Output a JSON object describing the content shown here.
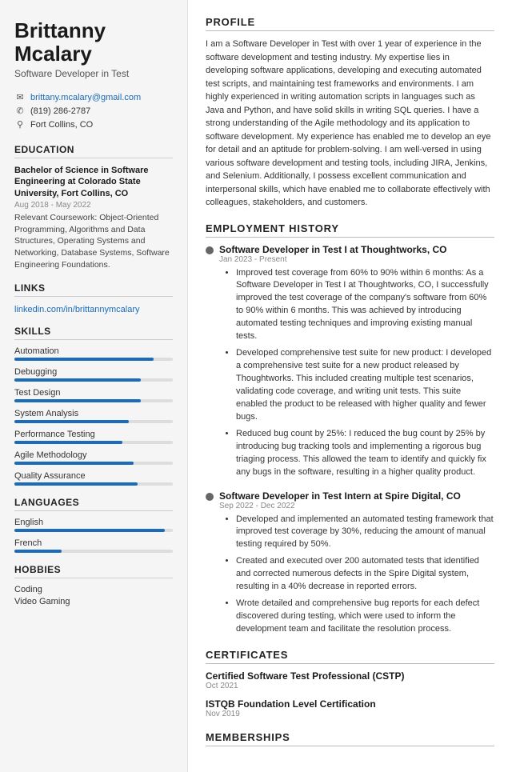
{
  "sidebar": {
    "name_line1": "Brittanny",
    "name_line2": "Mcalary",
    "title": "Software Developer in Test",
    "contact": {
      "email": "brittany.mcalary@gmail.com",
      "phone": "(819) 286-2787",
      "location": "Fort Collins, CO"
    },
    "sections": {
      "education": "EDUCATION",
      "links": "LINKS",
      "skills": "SKILLS",
      "languages": "LANGUAGES",
      "hobbies": "HOBBIES"
    },
    "education": {
      "degree": "Bachelor of Science in Software Engineering at Colorado State University, Fort Collins, CO",
      "date": "Aug 2018 - May 2022",
      "coursework_label": "Relevant Coursework:",
      "coursework": "Object-Oriented Programming, Algorithms and Data Structures, Operating Systems and Networking, Database Systems, Software Engineering Foundations."
    },
    "links": [
      {
        "label": "linkedin.com/in/brittannymcalary",
        "url": "#"
      }
    ],
    "skills": [
      {
        "label": "Automation",
        "pct": 88
      },
      {
        "label": "Debugging",
        "pct": 80
      },
      {
        "label": "Test Design",
        "pct": 80
      },
      {
        "label": "System Analysis",
        "pct": 72
      },
      {
        "label": "Performance Testing",
        "pct": 68
      },
      {
        "label": "Agile Methodology",
        "pct": 75
      },
      {
        "label": "Quality Assurance",
        "pct": 78
      }
    ],
    "languages": [
      {
        "label": "English",
        "pct": 95
      },
      {
        "label": "French",
        "pct": 30
      }
    ],
    "hobbies": [
      "Coding",
      "Video Gaming"
    ]
  },
  "main": {
    "profile_header": "PROFILE",
    "profile_text": "I am a Software Developer in Test with over 1 year of experience in the software development and testing industry. My expertise lies in developing software applications, developing and executing automated test scripts, and maintaining test frameworks and environments. I am highly experienced in writing automation scripts in languages such as Java and Python, and have solid skills in writing SQL queries. I have a strong understanding of the Agile methodology and its application to software development. My experience has enabled me to develop an eye for detail and an aptitude for problem-solving. I am well-versed in using various software development and testing tools, including JIRA, Jenkins, and Selenium. Additionally, I possess excellent communication and interpersonal skills, which have enabled me to collaborate effectively with colleagues, stakeholders, and customers.",
    "employment_header": "EMPLOYMENT HISTORY",
    "jobs": [
      {
        "title": "Software Developer in Test I at Thoughtworks, CO",
        "date": "Jan 2023 - Present",
        "bullets": [
          "Improved test coverage from 60% to 90% within 6 months: As a Software Developer in Test I at Thoughtworks, CO, I successfully improved the test coverage of the company's software from 60% to 90% within 6 months. This was achieved by introducing automated testing techniques and improving existing manual tests.",
          "Developed comprehensive test suite for new product: I developed a comprehensive test suite for a new product released by Thoughtworks. This included creating multiple test scenarios, validating code coverage, and writing unit tests. This suite enabled the product to be released with higher quality and fewer bugs.",
          "Reduced bug count by 25%: I reduced the bug count by 25% by introducing bug tracking tools and implementing a rigorous bug triaging process. This allowed the team to identify and quickly fix any bugs in the software, resulting in a higher quality product."
        ]
      },
      {
        "title": "Software Developer in Test Intern at Spire Digital, CO",
        "date": "Sep 2022 - Dec 2022",
        "bullets": [
          "Developed and implemented an automated testing framework that improved test coverage by 30%, reducing the amount of manual testing required by 50%.",
          "Created and executed over 200 automated tests that identified and corrected numerous defects in the Spire Digital system, resulting in a 40% decrease in reported errors.",
          "Wrote detailed and comprehensive bug reports for each defect discovered during testing, which were used to inform the development team and facilitate the resolution process."
        ]
      }
    ],
    "certificates_header": "CERTIFICATES",
    "certificates": [
      {
        "name": "Certified Software Test Professional (CSTP)",
        "date": "Oct 2021"
      },
      {
        "name": "ISTQB Foundation Level Certification",
        "date": "Nov 2019"
      }
    ],
    "memberships_header": "MEMBERSHIPS"
  }
}
